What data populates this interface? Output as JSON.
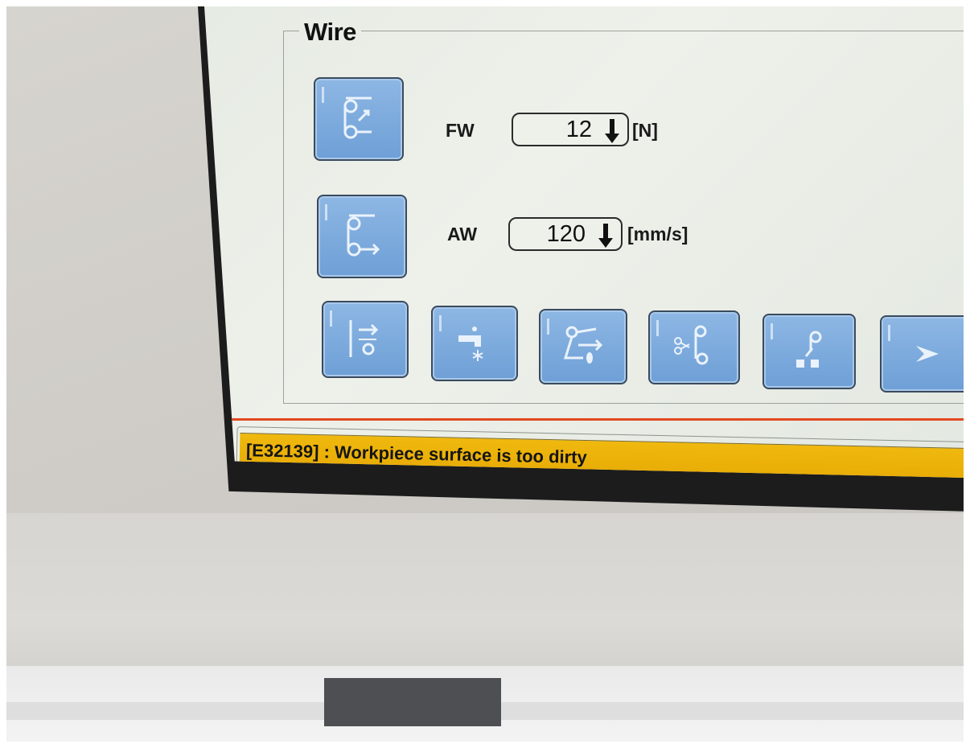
{
  "group": {
    "title": "Wire"
  },
  "params": [
    {
      "label": "FW",
      "value": "12",
      "unit": "[N]"
    },
    {
      "label": "AW",
      "value": "120",
      "unit": "[mm/s]"
    }
  ],
  "icons": {
    "fw": "wire-tension-icon",
    "aw": "wire-speed-icon",
    "row": [
      "wire-thread-icon",
      "flushing-icon",
      "wire-feed-icon",
      "wire-cut-icon",
      "wire-dispose-icon",
      "next-icon"
    ]
  },
  "error": {
    "text": "[E32139] : Workpiece surface is too dirty"
  },
  "colors": {
    "button": "#7aa9dc",
    "error_bar": "#eab10a",
    "separator": "#e2481f"
  }
}
